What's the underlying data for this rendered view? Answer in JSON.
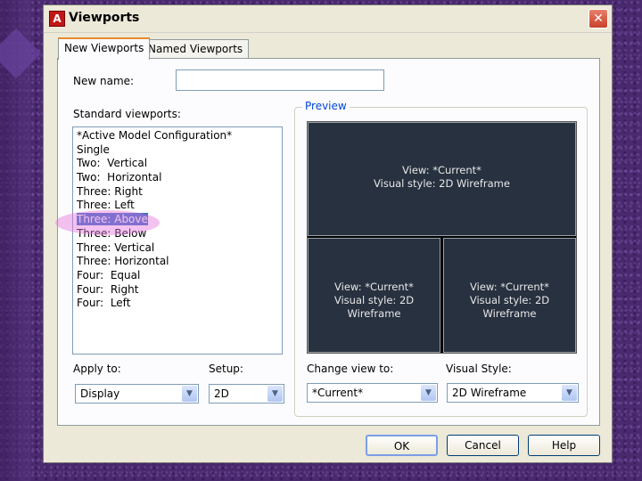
{
  "window": {
    "title": "Viewports",
    "app_icon": "A",
    "close_label": "✕"
  },
  "tabs": [
    {
      "label": "New Viewports",
      "active": true
    },
    {
      "label": "Named Viewports",
      "active": false
    }
  ],
  "new_name": {
    "label": "New name:",
    "value": ""
  },
  "standard_viewports": {
    "label": "Standard viewports:",
    "items": [
      "*Active Model Configuration*",
      "Single",
      "Two:  Vertical",
      "Two:  Horizontal",
      "Three: Right",
      "Three: Left",
      "Three: Above",
      "Three: Below",
      "Three: Vertical",
      "Three: Horizontal",
      "Four:  Equal",
      "Four:  Right",
      "Four:  Left"
    ],
    "selected_index": 6
  },
  "preview": {
    "label": "Preview",
    "panes": [
      {
        "view": "View: *Current*",
        "style": "Visual style: 2D Wireframe"
      },
      {
        "view": "View: *Current*",
        "style": "Visual style: 2D Wireframe"
      },
      {
        "view": "View: *Current*",
        "style": "Visual style: 2D Wireframe"
      }
    ]
  },
  "apply_to": {
    "label": "Apply to:",
    "value": "Display"
  },
  "setup": {
    "label": "Setup:",
    "value": "2D"
  },
  "change_view_to": {
    "label": "Change view to:",
    "value": "*Current*"
  },
  "visual_style": {
    "label": "Visual Style:",
    "value": "2D Wireframe"
  },
  "buttons": {
    "ok": "OK",
    "cancel": "Cancel",
    "help": "Help"
  },
  "colors": {
    "selection": "#316ac5",
    "highlight": "#e678dc",
    "preview_bg": "#27313f",
    "group_label": "#0046d5"
  }
}
